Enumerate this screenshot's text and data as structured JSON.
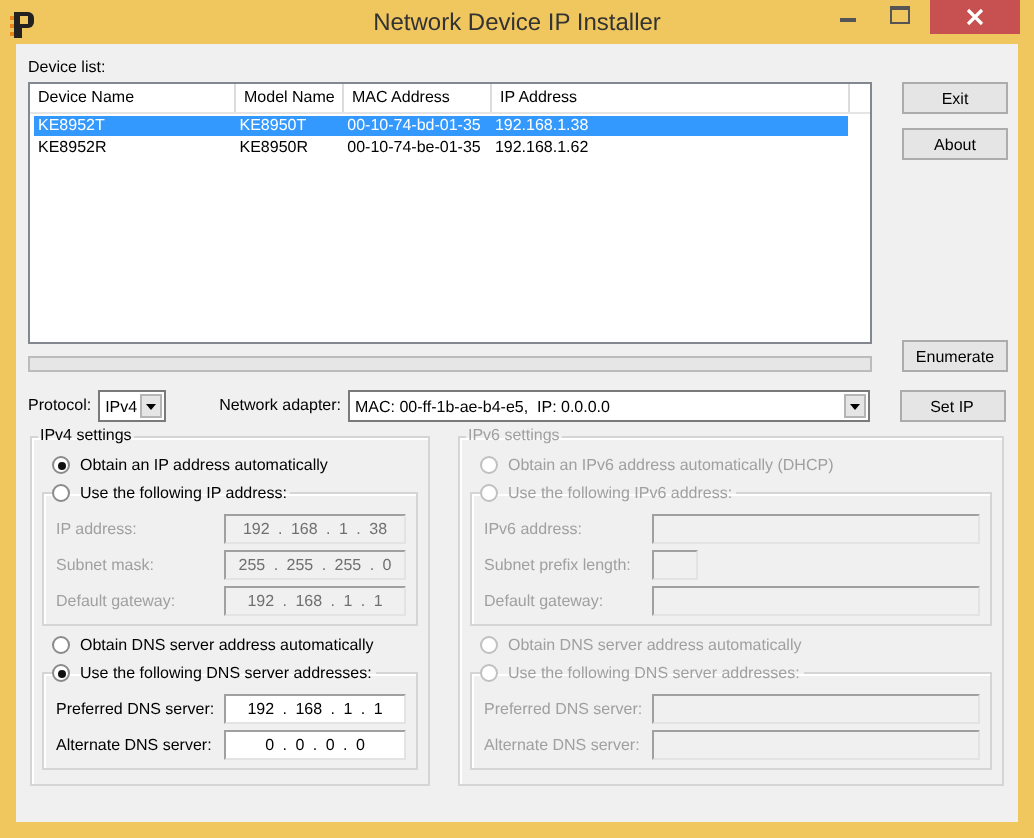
{
  "window": {
    "title": "Network Device IP Installer"
  },
  "device_list": {
    "label": "Device list:",
    "columns": [
      "Device Name",
      "Model Name",
      "MAC Address",
      "IP Address"
    ],
    "rows": [
      {
        "cells": [
          "KE8952T",
          "KE8950T",
          "00-10-74-bd-01-35",
          "192.168.1.38"
        ],
        "selected": true
      },
      {
        "cells": [
          "KE8952R",
          "KE8950R",
          "00-10-74-be-01-35",
          "192.168.1.62"
        ],
        "selected": false
      }
    ]
  },
  "progress": {
    "level": 0
  },
  "side_buttons": [
    "Exit",
    "About"
  ],
  "enumerate_button": "Enumerate",
  "set_ip_button": "Set IP",
  "protocol": {
    "label": "Protocol:",
    "value": "IPv4"
  },
  "network_adapter": {
    "label": "Network adapter:",
    "value": "MAC: 00-ff-1b-ae-b4-e5,  IP: 0.0.0.0"
  },
  "groups": [
    {
      "title": "IPv4 settings",
      "disabled": false,
      "sections": [
        {
          "kind": "radio",
          "label": "Obtain an IP address automatically",
          "selected": true
        },
        {
          "kind": "radio_group",
          "label": "Use the following IP address:",
          "selected": false,
          "fields": [
            {
              "label": "IP address:",
              "value": "192 . 168 . 1 . 38",
              "disabled": true,
              "kind": "wide"
            },
            {
              "label": "Subnet mask:",
              "value": "255 . 255 . 255 . 0",
              "disabled": true,
              "kind": "wide"
            },
            {
              "label": "Default gateway:",
              "value": "192 . 168 . 1 . 1",
              "disabled": true,
              "kind": "wide"
            }
          ]
        },
        {
          "kind": "radio",
          "label": "Obtain DNS server address automatically",
          "selected": false
        },
        {
          "kind": "radio_group",
          "label": "Use the following DNS server addresses:",
          "selected": true,
          "fields": [
            {
              "label": "Preferred DNS server:",
              "value": "192 . 168 . 1 . 1",
              "disabled": false,
              "kind": "wide"
            },
            {
              "label": "Alternate DNS server:",
              "value": "0 . 0 . 0 . 0",
              "disabled": false,
              "kind": "wide"
            }
          ]
        }
      ]
    },
    {
      "title": "IPv6 settings",
      "disabled": true,
      "sections": [
        {
          "kind": "radio",
          "label": "Obtain an IPv6 address automatically (DHCP)",
          "selected": false
        },
        {
          "kind": "radio_group",
          "label": "Use the following IPv6 address:",
          "selected": false,
          "fields": [
            {
              "label": "IPv6 address:",
              "disabled": true,
              "kind": "wide"
            },
            {
              "label": "Subnet prefix length:",
              "disabled": true,
              "kind": "short"
            },
            {
              "label": "Default gateway:",
              "disabled": true,
              "kind": "wide"
            }
          ]
        },
        {
          "kind": "radio",
          "label": "Obtain DNS server address automatically",
          "selected": false
        },
        {
          "kind": "radio_group",
          "label": "Use the following DNS server addresses:",
          "selected": false,
          "fields": [
            {
              "label": "Preferred DNS server:",
              "disabled": true,
              "kind": "wide"
            },
            {
              "label": "Alternate DNS server:",
              "disabled": true,
              "kind": "wide"
            }
          ]
        }
      ]
    }
  ]
}
